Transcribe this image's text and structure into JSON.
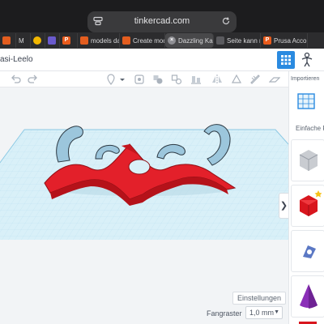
{
  "browser": {
    "url": "tinkercad.com",
    "tabs": [
      {
        "label": "",
        "favicon": "orange-square",
        "active": false
      },
      {
        "label": "M",
        "favicon": "dark-m",
        "active": false
      },
      {
        "label": "",
        "favicon": "yellow-swirl",
        "active": false
      },
      {
        "label": "",
        "favicon": "purple-g",
        "active": false
      },
      {
        "label": "P",
        "favicon": "prusa-orange",
        "active": false
      },
      {
        "label": "models dat...",
        "favicon": "orange-square",
        "active": false
      },
      {
        "label": "Create mod...",
        "favicon": "orange-square",
        "active": false
      },
      {
        "label": "Dazzling Ka...",
        "favicon": "close",
        "active": true
      },
      {
        "label": "Seite kann n...",
        "favicon": "link",
        "active": false
      },
      {
        "label": "Prusa Acco...",
        "favicon": "prusa-orange",
        "active": false
      }
    ]
  },
  "app": {
    "doc_title": "asi-Leelo"
  },
  "right_panel": {
    "import_label": "Importieren",
    "shapes_label": "Einfache Fo"
  },
  "viewport": {
    "settings_label": "Einstellungen",
    "snap_label": "Fangraster",
    "snap_value": "1,0 mm"
  },
  "colors": {
    "model_red": "#e3202a",
    "model_blue": "#9cc6dc",
    "grid_fill": "#d9f0f8",
    "accent_blue": "#2a8ae0"
  }
}
